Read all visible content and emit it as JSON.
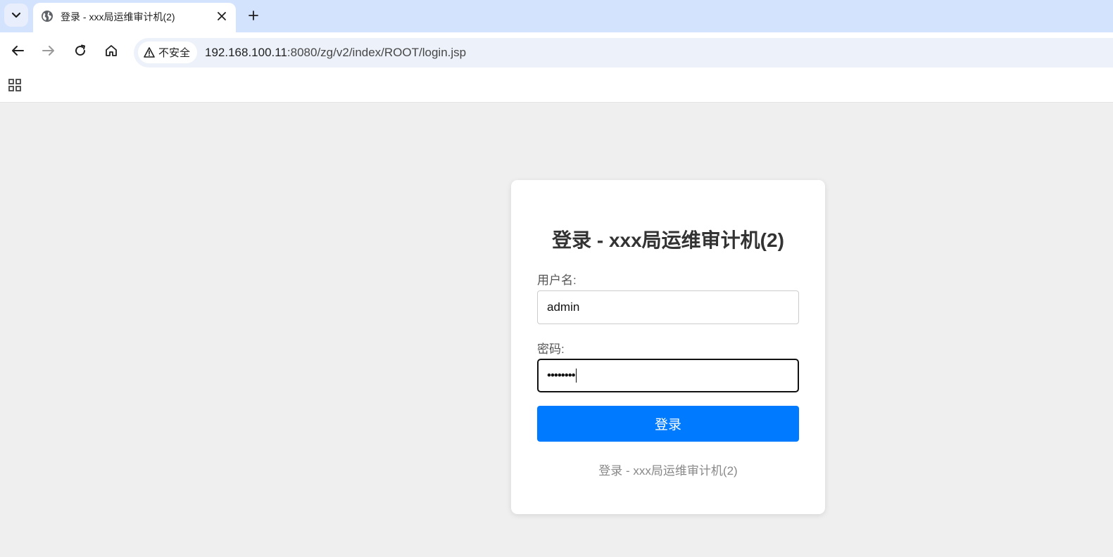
{
  "browser": {
    "tab": {
      "title": "登录 - xxx局运维审计机(2)",
      "favicon": "globe-icon"
    },
    "address_bar": {
      "security_label": "不安全",
      "url_host": "192.168.100.11",
      "url_rest": ":8080/zg/v2/index/ROOT/login.jsp"
    },
    "icons": {
      "tab_menu": "chevron-down-icon",
      "close_tab": "close-icon",
      "new_tab": "plus-icon",
      "back": "arrow-left-icon",
      "forward": "arrow-right-icon",
      "reload": "reload-icon",
      "home": "home-icon",
      "warning": "warning-icon",
      "apps": "apps-grid-icon"
    }
  },
  "login": {
    "title": "登录 - xxx局运维审计机(2)",
    "username_label": "用户名:",
    "username_value": "admin",
    "password_label": "密码:",
    "password_masked": "••••••••",
    "submit_label": "登录",
    "footer": "登录 - xxx局运维审计机(2)"
  },
  "colors": {
    "tabstrip": "#d3e3fd",
    "page_background": "#efefef",
    "primary_button": "#007bff"
  }
}
